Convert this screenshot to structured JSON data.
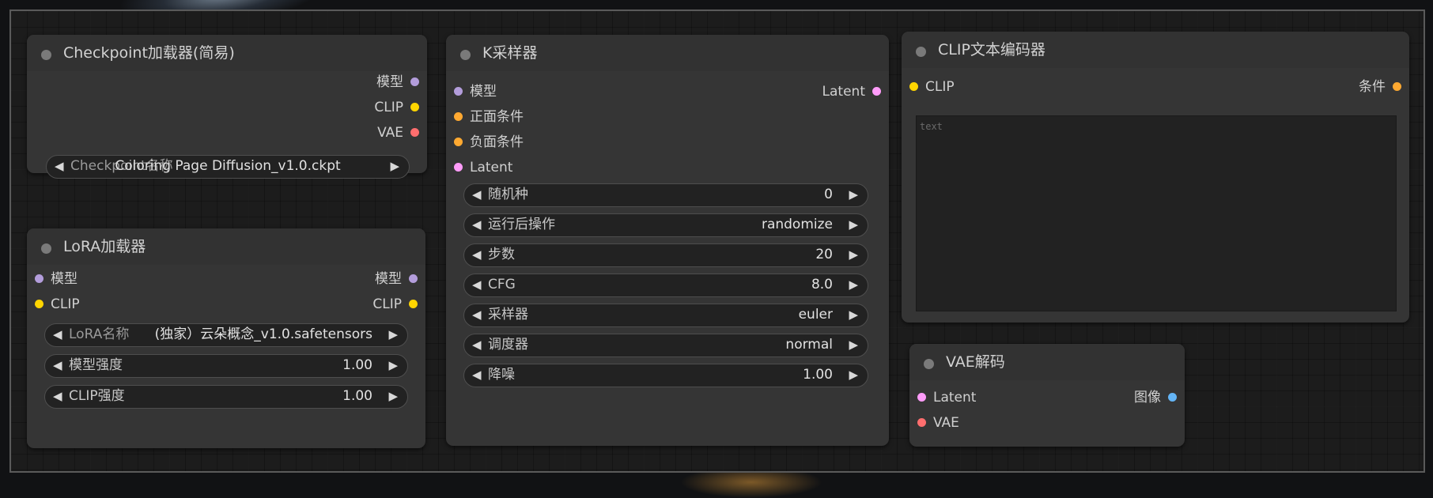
{
  "nodes": {
    "checkpoint": {
      "title": "Checkpoint加载器(简易)",
      "outputs": [
        "模型",
        "CLIP",
        "VAE"
      ],
      "widget": {
        "label": "Checkpoint名称",
        "value": "Coloring Page Diffusion_v1.0.ckpt"
      }
    },
    "lora": {
      "title": "LoRA加载器",
      "inputs": [
        "模型",
        "CLIP"
      ],
      "outputs": [
        "模型",
        "CLIP"
      ],
      "widgets": [
        {
          "label": "LoRA名称",
          "value": "(独家）云朵概念_v1.0.safetensors"
        },
        {
          "label": "模型强度",
          "value": "1.00"
        },
        {
          "label": "CLIP强度",
          "value": "1.00"
        }
      ]
    },
    "ksampler": {
      "title": "K采样器",
      "inputs": [
        "模型",
        "正面条件",
        "负面条件",
        "Latent"
      ],
      "outputs": [
        "Latent"
      ],
      "widgets": [
        {
          "label": "随机种",
          "value": "0"
        },
        {
          "label": "运行后操作",
          "value": "randomize"
        },
        {
          "label": "步数",
          "value": "20"
        },
        {
          "label": "CFG",
          "value": "8.0"
        },
        {
          "label": "采样器",
          "value": "euler"
        },
        {
          "label": "调度器",
          "value": "normal"
        },
        {
          "label": "降噪",
          "value": "1.00"
        }
      ]
    },
    "clip_text": {
      "title": "CLIP文本编码器",
      "inputs": [
        "CLIP"
      ],
      "outputs": [
        "条件"
      ],
      "text_placeholder": "text"
    },
    "vae_decode": {
      "title": "VAE解码",
      "inputs": [
        "Latent",
        "VAE"
      ],
      "outputs": [
        "图像"
      ]
    }
  },
  "arrows": {
    "left": "◀",
    "right": "▶"
  },
  "colors": {
    "model": "#b39ddb",
    "clip": "#ffd500",
    "vae": "#ff6e6e",
    "latent": "#ff9cf9",
    "conditioning": "#ffa931",
    "image": "#64b5f6"
  }
}
